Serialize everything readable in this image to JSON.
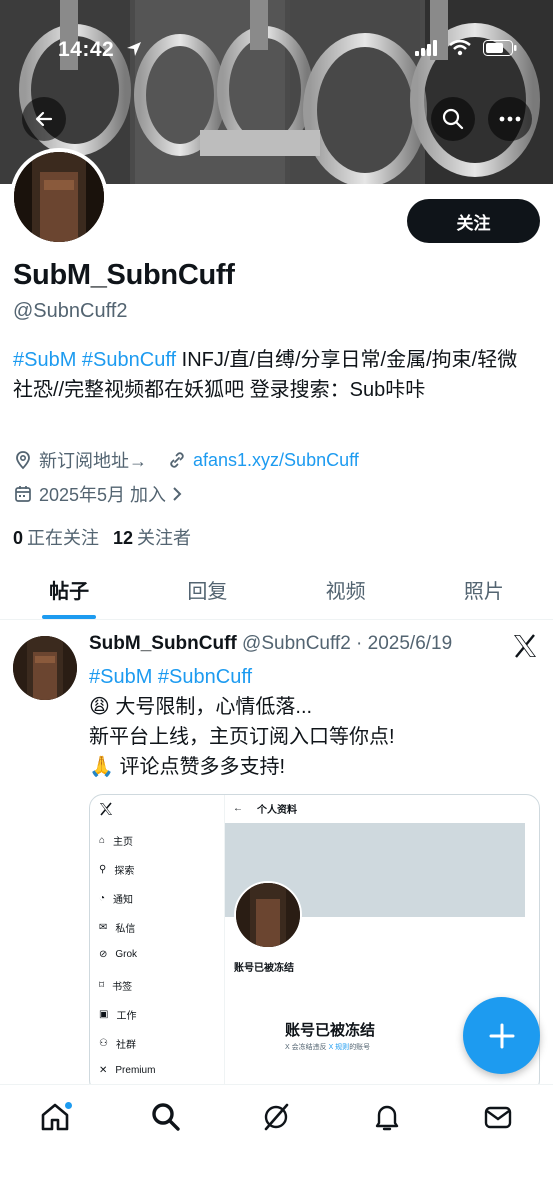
{
  "status_bar": {
    "time": "14:42"
  },
  "profile": {
    "display_name": "SubM_SubnCuff",
    "handle": "@SubnCuff2",
    "follow_label": "关注",
    "bio_tags": "#SubM #SubnCuff",
    "bio_text": " INFJ/直/自缚/分享日常/金属/拘束/轻微社恐//完整视频都在妖狐吧 登录搜索：Sub咔咔",
    "location_text": "新订阅地址→",
    "website": "afans1.xyz/SubnCuff",
    "joined": "2025年5月 加入",
    "following_count": "0",
    "following_label": "正在关注",
    "followers_count": "12",
    "followers_label": "关注者"
  },
  "tabs": [
    {
      "label": "帖子",
      "active": true
    },
    {
      "label": "回复",
      "active": false
    },
    {
      "label": "视频",
      "active": false
    },
    {
      "label": "照片",
      "active": false
    }
  ],
  "post": {
    "name": "SubM_SubnCuff",
    "meta": " @SubnCuff2 · 2025/6/19",
    "tags": "#SubM #SubnCuff",
    "line1": "😩 大号限制，心情低落...",
    "line2": "新平台上线，主页订阅入口等你点!",
    "line3": "🙏 评论点赞多多支持!"
  },
  "embed": {
    "page_title": "个人资料",
    "nav_items": [
      "主页",
      "探索",
      "通知",
      "私信",
      "Grok",
      "书签",
      "工作",
      "社群",
      "Premium"
    ],
    "frozen_small": "账号已被冻结",
    "frozen_big": "账号已被冻结",
    "frozen_note_a": "X 会冻结违反 ",
    "frozen_note_link": "X 规则",
    "frozen_note_b": "的账号"
  },
  "colors": {
    "accent": "#1d9bf0",
    "text": "#0f1419",
    "muted": "#536471"
  },
  "icons": [
    "back-arrow-icon",
    "search-icon",
    "more-icon",
    "location-icon",
    "link-icon",
    "calendar-icon",
    "chevron-right-icon",
    "x-logo-icon",
    "plus-icon",
    "home-icon",
    "grok-icon",
    "bell-icon",
    "mail-icon"
  ]
}
